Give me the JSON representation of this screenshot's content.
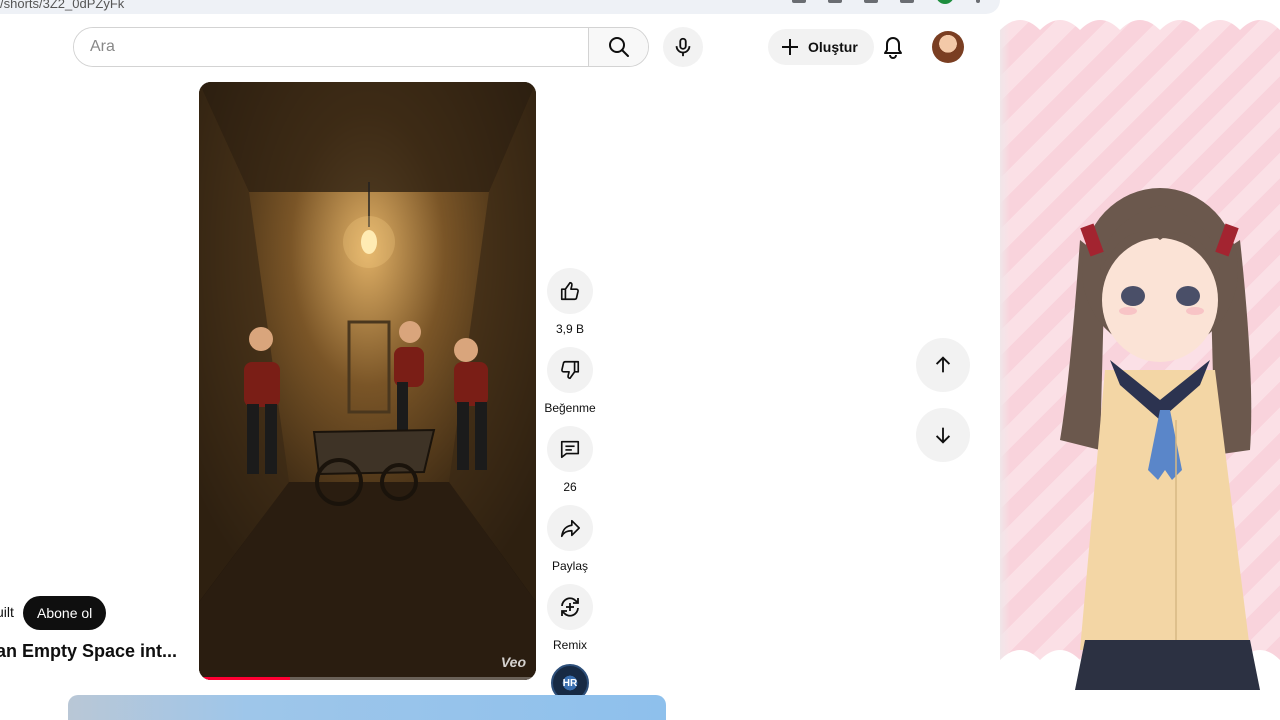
{
  "address_bar": {
    "url": "/shorts/3Z2_0dPZyFk"
  },
  "search": {
    "placeholder": "Ara"
  },
  "header": {
    "create_label": "Oluştur"
  },
  "actions": {
    "like_count": "3,9 B",
    "dislike_label": "Beğenme",
    "comment_count": "26",
    "share_label": "Paylaş",
    "remix_label": "Remix",
    "channel_badge": "HR"
  },
  "video": {
    "watermark": "Veo",
    "progress_fraction": 0.27
  },
  "channel": {
    "name_fragment": "uilt",
    "subscribe_label": "Abone ol"
  },
  "short": {
    "title_fragment": "an Empty Space int..."
  },
  "colors": {
    "accent_red": "#ff0033",
    "chip_bg": "#f2f2f2",
    "subscribe_bg": "#0f0f0f",
    "side_pink": "#f9d3dc"
  }
}
